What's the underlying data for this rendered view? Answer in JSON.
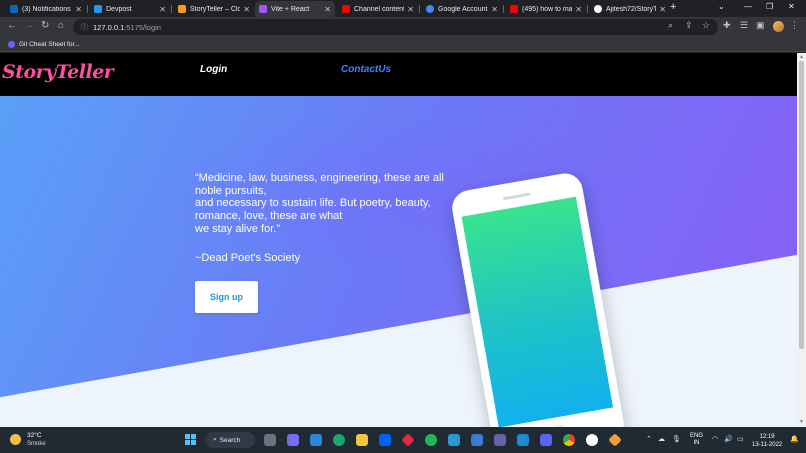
{
  "browser": {
    "tabs": [
      {
        "title": "(3) Notifications |",
        "favicon_color": "#0a66c2",
        "active": false
      },
      {
        "title": "Devpost",
        "favicon_color": "#1d9bf0",
        "active": false
      },
      {
        "title": "StoryTeller – Clou",
        "favicon_color": "#f6a019",
        "active": false
      },
      {
        "title": "Vite + React",
        "favicon_color": "#a855f7",
        "active": true
      },
      {
        "title": "Channel content",
        "favicon_color": "#ff0000",
        "active": false
      },
      {
        "title": "Google Account",
        "favicon_color": "#4285f4",
        "active": false
      },
      {
        "title": "(495) how to mak",
        "favicon_color": "#ff0000",
        "active": false
      },
      {
        "title": "Ajitesh72/StoryTe",
        "favicon_color": "#ffffff",
        "active": false
      }
    ],
    "new_tab": "+",
    "url_host": "127.0.0.1",
    "url_path": ":5175/login",
    "bookmark": "Git Cheat Sheet for..."
  },
  "site": {
    "logo": "StoryTeller",
    "nav": {
      "login": "Login",
      "contact": "ContactUs"
    },
    "quote_lines": [
      "“Medicine, law, business, engineering, these are all",
      "noble pursuits,",
      "and necessary to sustain life. But poetry, beauty,",
      "romance, love, these are what",
      "we stay alive for.”"
    ],
    "attribution": "~Dead Poet's Society",
    "signup_label": "Sign up",
    "colors": {
      "logo": "#ff4fa3",
      "contact_link": "#3b82f6",
      "signup_text": "#1a9bd7"
    }
  },
  "taskbar": {
    "temperature": "32°C",
    "condition": "Smoke",
    "search_label": "Search",
    "language": "ENG",
    "region": "IN",
    "time": "12:19",
    "date": "13-11-2022"
  }
}
